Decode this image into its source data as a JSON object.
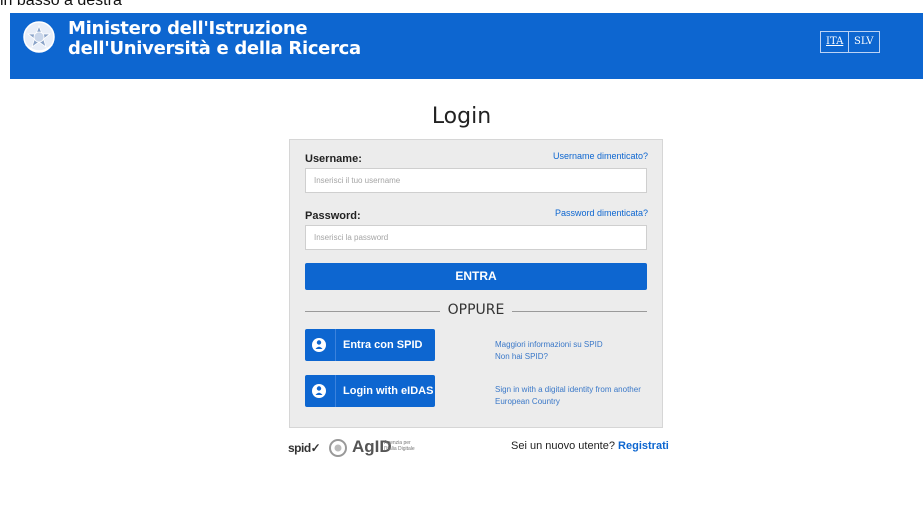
{
  "caption": "in basso a destra",
  "header": {
    "ministry_line1": "Ministero dell'Istruzione",
    "ministry_line2": "dell'Università e della Ricerca",
    "lang_ita": "ITA",
    "lang_slv": "SLV",
    "color": "#0d66d0"
  },
  "login": {
    "title": "Login",
    "username_label": "Username:",
    "username_forgot": "Username dimenticato?",
    "username_placeholder": "Inserisci il tuo username",
    "password_label": "Password:",
    "password_forgot": "Password dimenticata?",
    "password_placeholder": "Inserisci la password",
    "submit_label": "ENTRA",
    "or_label": "OPPURE"
  },
  "identity": {
    "spid_button": "Entra con SPID",
    "spid_info_1": "Maggiori informazioni su SPID",
    "spid_info_2": "Non hai SPID?",
    "eidas_button": "Login with eIDAS",
    "eidas_info_1": "Sign in with a digital identity from another",
    "eidas_info_2": "European Country",
    "icon": "user-icon"
  },
  "footer": {
    "spid_logo": "spid✓",
    "agid_logo": "AgID",
    "agid_sub": "Agenzia per l'Italia Digitale",
    "new_user_text": "Sei un nuovo utente?",
    "register_link": "Registrati"
  }
}
